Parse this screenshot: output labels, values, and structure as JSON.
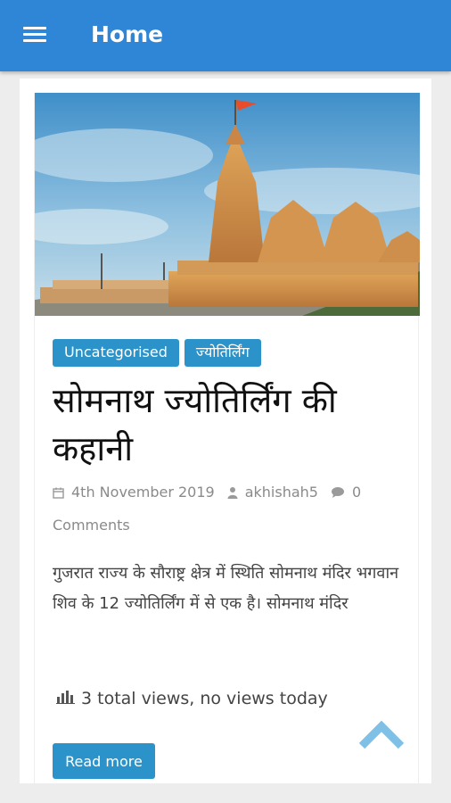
{
  "appbar": {
    "title": "Home",
    "menu_icon": "hamburger-menu-icon",
    "color": "#2f86d6"
  },
  "post": {
    "image_alt": "Somnath temple",
    "categories": [
      "Uncategorised",
      "ज्योतिर्लिंग"
    ],
    "title": "सोमनाथ ज्योतिर्लिंग की कहानी",
    "date": "4th November 2019",
    "author": "akhishah5",
    "comments": "0 Comments",
    "excerpt": "गुजरात राज्य के सौराष्ट्र क्षेत्र में स्थिति सोमनाथ मंदिर भगवान शिव के 12 ज्योतिर्लिंग में से एक है। सोमनाथ मंदिर",
    "views": "3 total views, no views today",
    "read_more": "Read more"
  },
  "colors": {
    "accent": "#2b93c9",
    "scroll_top": "#7fc0e6"
  }
}
